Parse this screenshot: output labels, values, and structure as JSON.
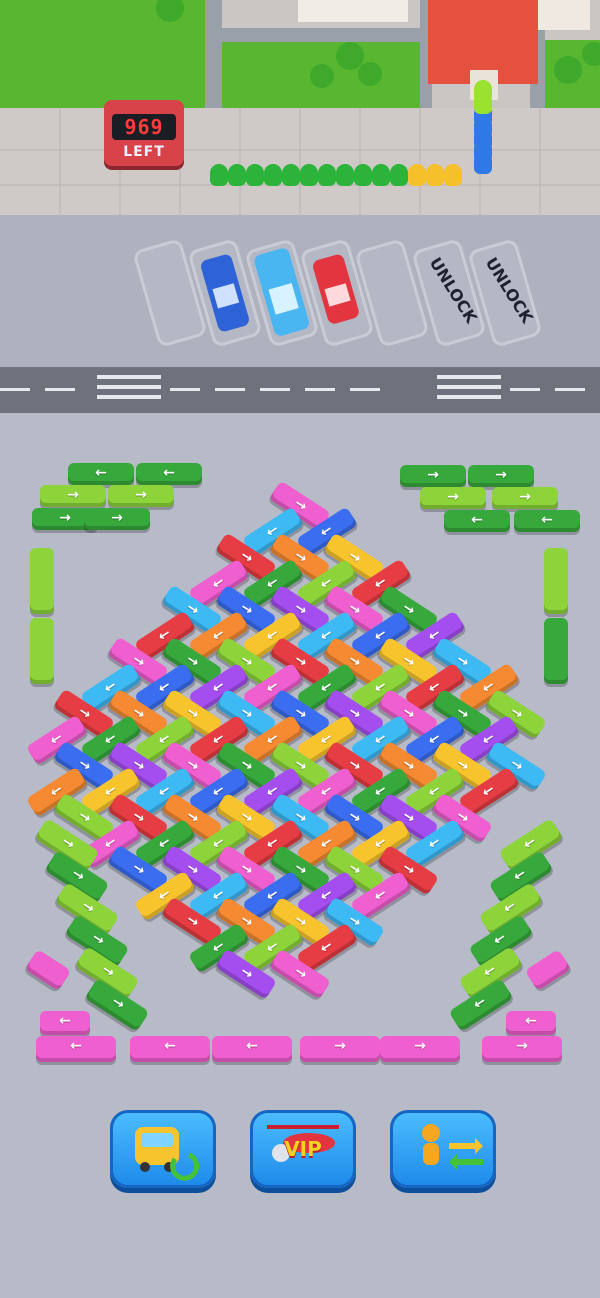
{
  "counter": {
    "value": "969",
    "label": "LEFT"
  },
  "parking": {
    "slots": [
      {
        "state": "empty"
      },
      {
        "state": "occupied",
        "bus_color": "#2e63d8"
      },
      {
        "state": "occupied",
        "bus_color": "#49b6f2"
      },
      {
        "state": "occupied",
        "bus_color": "#e2353f"
      },
      {
        "state": "empty"
      },
      {
        "state": "locked",
        "label": "UNLOCK"
      },
      {
        "state": "locked",
        "label": "UNLOCK"
      }
    ]
  },
  "passenger_queue": {
    "colors": [
      "#2cb33a",
      "#2cb33a",
      "#2cb33a",
      "#2cb33a",
      "#2cb33a",
      "#2cb33a",
      "#2cb33a",
      "#2cb33a",
      "#2cb33a",
      "#2cb33a",
      "#2cb33a",
      "#f5c02a",
      "#f5c02a",
      "#f5c02a",
      "#2f78e8",
      "#2f78e8",
      "#2f78e8",
      "#2f78e8",
      "#2f78e8",
      "#9be12f",
      "#9be12f"
    ]
  },
  "palette": {
    "green": "#37a93c",
    "lime": "#8cd43a",
    "pink": "#f05fcf",
    "purple": "#a54ef0",
    "blue": "#3a6df0",
    "cyan": "#3db9f4",
    "yellow": "#f7c42e",
    "orange": "#f58a32",
    "red": "#e63c43",
    "road": "#6d727d",
    "board": "#b7bac7",
    "accent_button": "#1f8bea"
  },
  "buttons": [
    {
      "name": "shuffle-buses",
      "icon": "yellow-bus-shuffle-icon",
      "label": ""
    },
    {
      "name": "vip-helicopter",
      "icon": "vip-helicopter-icon",
      "label": "VIP"
    },
    {
      "name": "swap-passengers",
      "icon": "person-swap-icon",
      "label": ""
    }
  ]
}
